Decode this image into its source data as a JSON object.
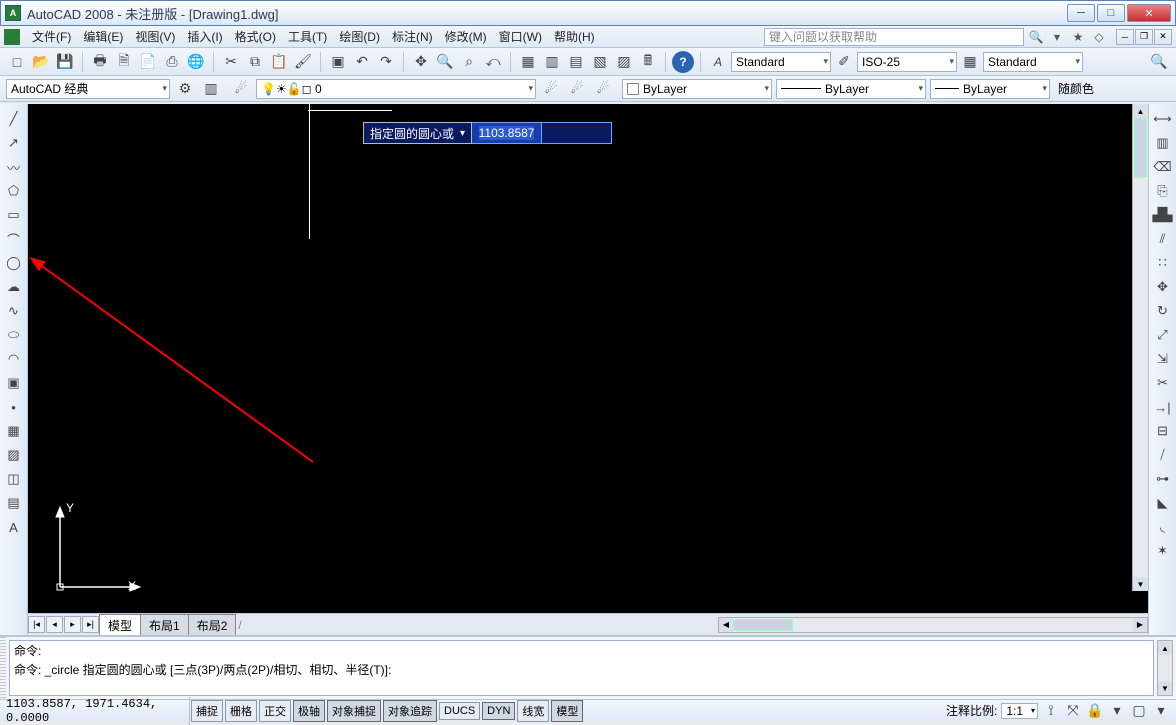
{
  "title": "AutoCAD 2008 - 未注册版 - [Drawing1.dwg]",
  "menu": {
    "items": [
      "文件(F)",
      "编辑(E)",
      "视图(V)",
      "插入(I)",
      "格式(O)",
      "工具(T)",
      "绘图(D)",
      "标注(N)",
      "修改(M)",
      "窗口(W)",
      "帮助(H)"
    ],
    "help_placeholder": "键入问题以获取帮助"
  },
  "styles_row": {
    "text_style": "Standard",
    "dim_style": "ISO-25",
    "table_style": "Standard"
  },
  "workspace": {
    "name": "AutoCAD 经典",
    "layer_value": "0",
    "prop_layer": "ByLayer",
    "prop_ltype": "ByLayer",
    "prop_lweight": "ByLayer",
    "prop_color": "随颜色"
  },
  "dyn": {
    "prompt": "指定圆的圆心或",
    "value": "1103.8587"
  },
  "ucs": {
    "x": "X",
    "y": "Y"
  },
  "tabs": {
    "model": "模型",
    "layout1": "布局1",
    "layout2": "布局2"
  },
  "cmd": {
    "line1": "命令:",
    "line2": "命令: _circle 指定圆的圆心或 [三点(3P)/两点(2P)/相切、相切、半径(T)]:"
  },
  "status": {
    "coords": "1103.8587, 1971.4634, 0.0000",
    "toggles": [
      "捕捉",
      "栅格",
      "正交",
      "极轴",
      "对象捕捉",
      "对象追踪",
      "DUCS",
      "DYN",
      "线宽",
      "模型"
    ],
    "scale_label": "注释比例:",
    "scale_value": "1:1"
  },
  "left_tools": [
    "line",
    "xline",
    "pline",
    "polygon",
    "rect",
    "arc",
    "circle",
    "revcloud",
    "spline",
    "ellipse",
    "ellipse-arc",
    "block",
    "point",
    "hatch",
    "gradient",
    "region",
    "table",
    "text"
  ],
  "right_tools": [
    "dist",
    "pan",
    "erase",
    "copy",
    "mirror",
    "offset",
    "array",
    "move",
    "rotate",
    "scale",
    "stretch",
    "trim",
    "extend",
    "break-pt",
    "break",
    "join",
    "chamfer",
    "fillet",
    "explode"
  ]
}
